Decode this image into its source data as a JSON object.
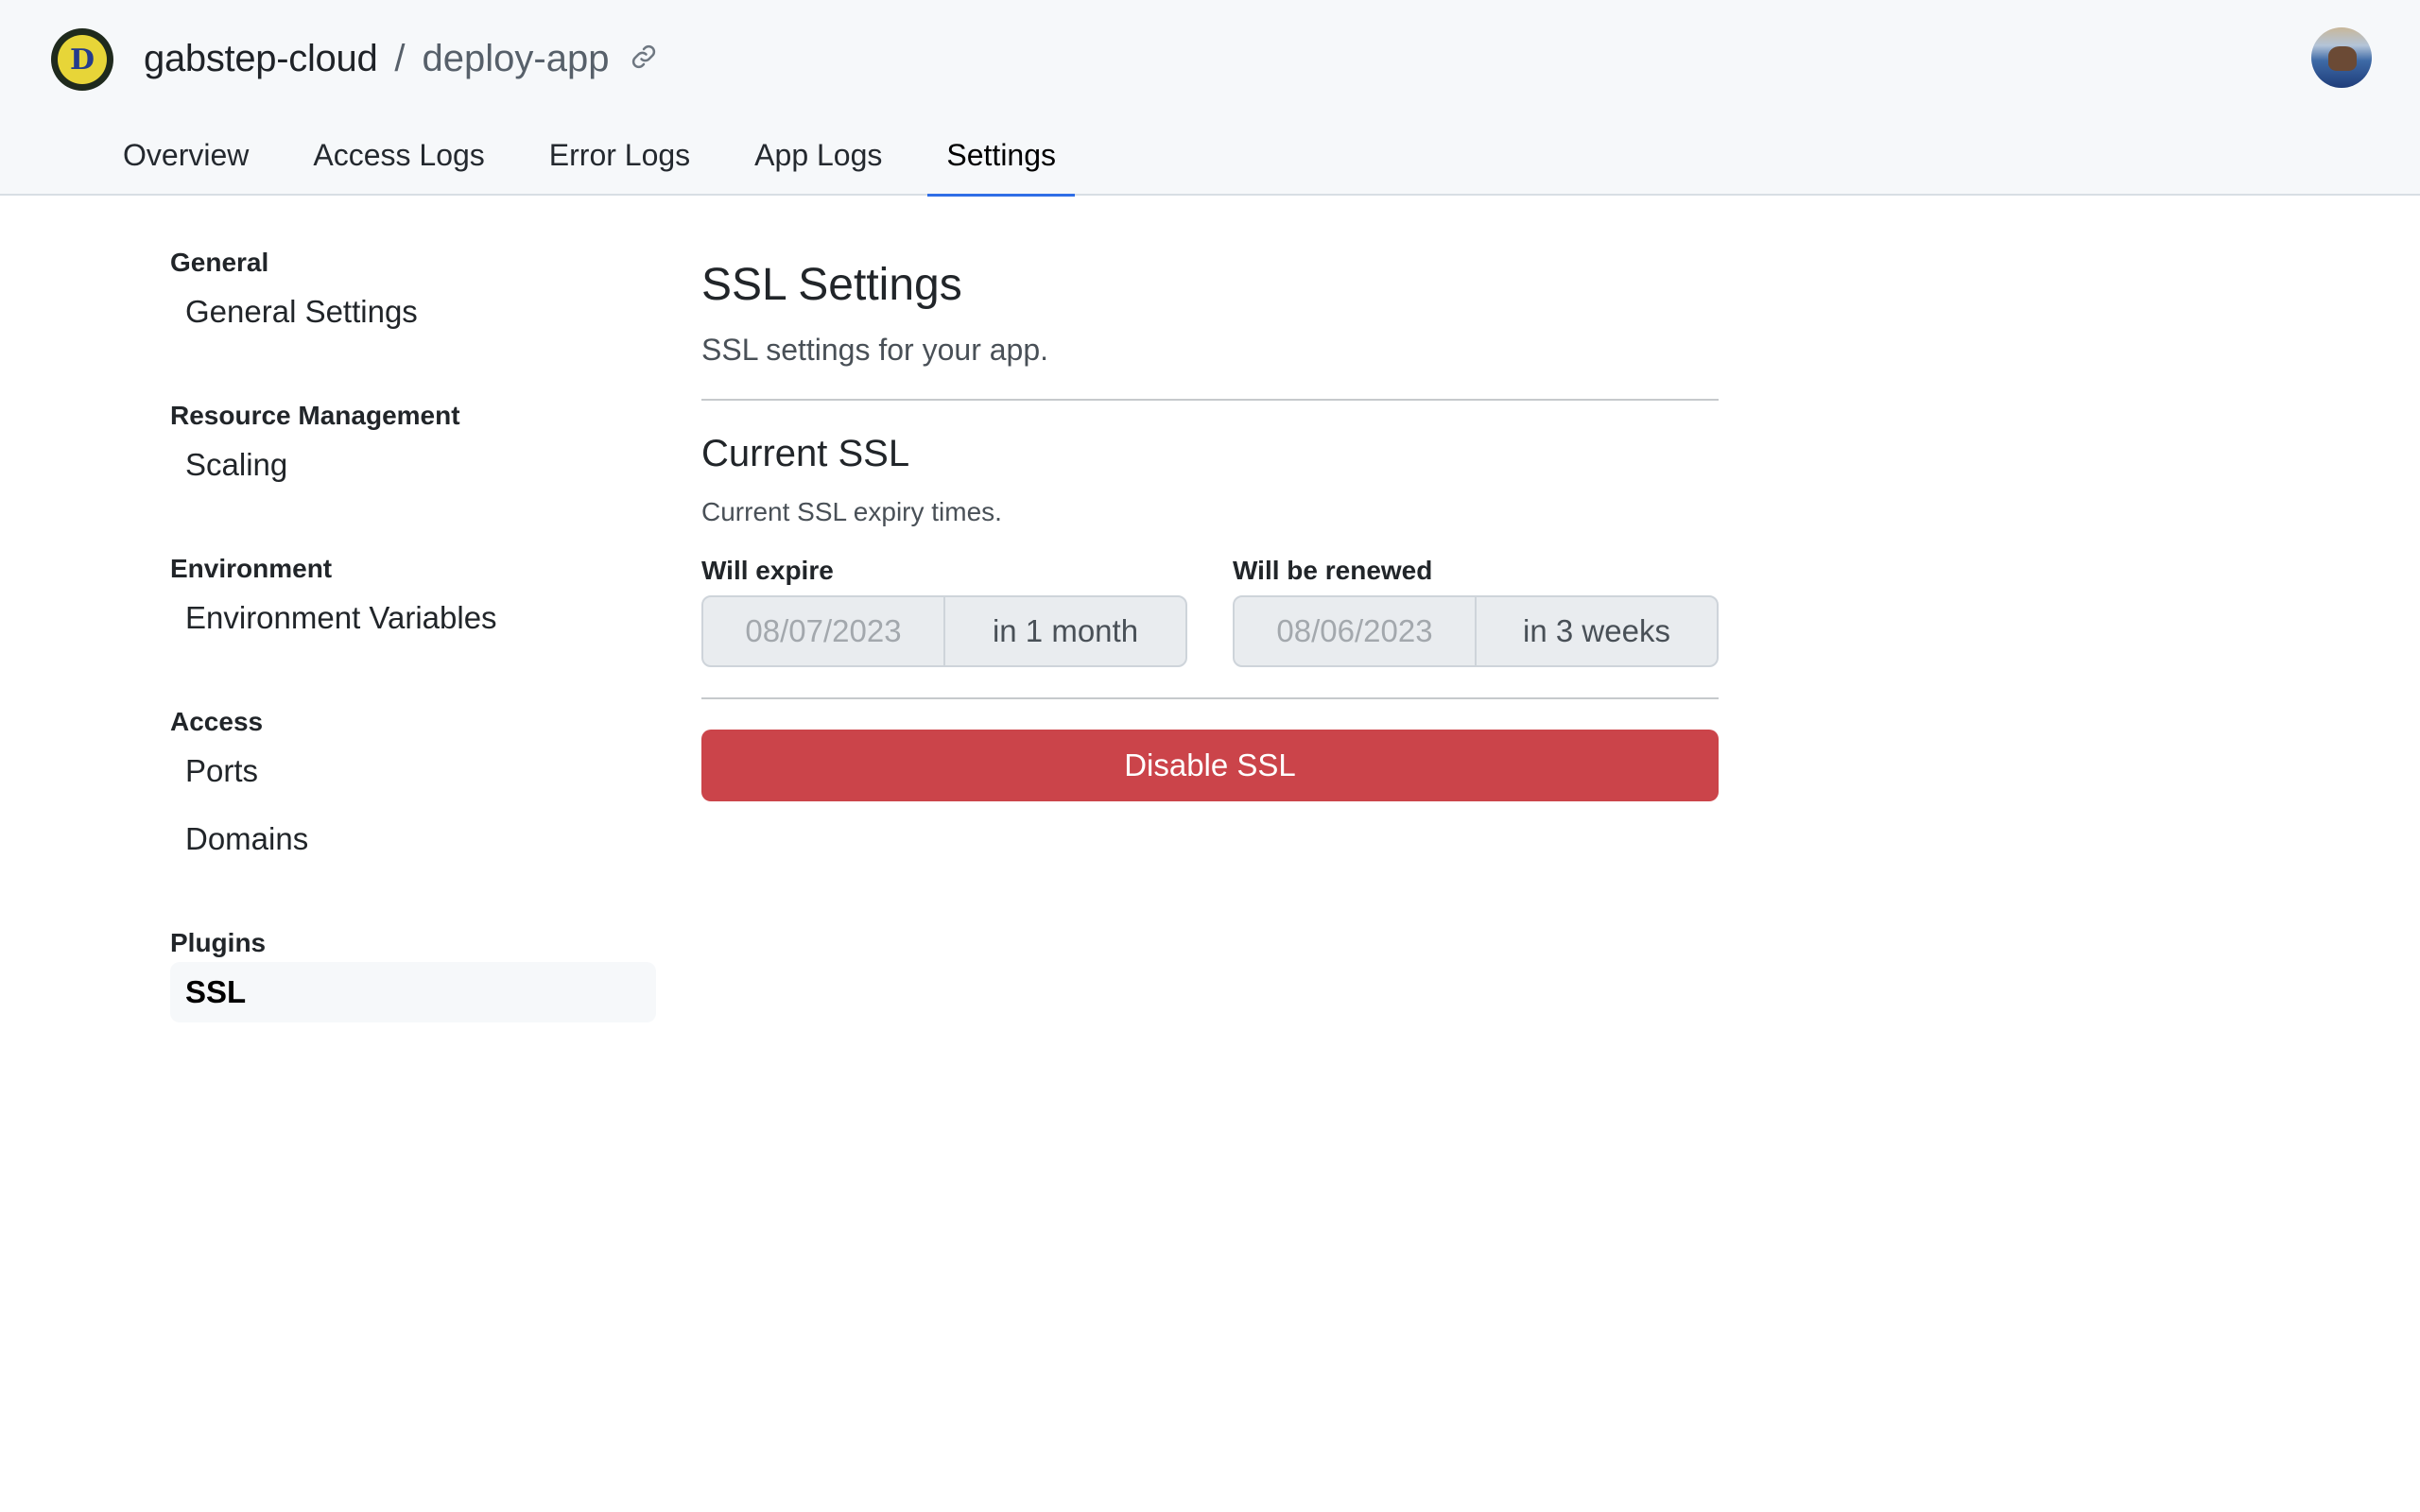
{
  "header": {
    "org_name": "gabstep-cloud",
    "separator": "/",
    "app_name": "deploy-app",
    "logo_letter": "D",
    "link_icon": "link-icon",
    "avatar_icon": "user-avatar"
  },
  "tabs": [
    {
      "label": "Overview",
      "active": false
    },
    {
      "label": "Access Logs",
      "active": false
    },
    {
      "label": "Error Logs",
      "active": false
    },
    {
      "label": "App Logs",
      "active": false
    },
    {
      "label": "Settings",
      "active": true
    }
  ],
  "sidebar": {
    "groups": [
      {
        "heading": "General",
        "items": [
          {
            "label": "General Settings",
            "active": false
          }
        ]
      },
      {
        "heading": "Resource Management",
        "items": [
          {
            "label": "Scaling",
            "active": false
          }
        ]
      },
      {
        "heading": "Environment",
        "items": [
          {
            "label": "Environment Variables",
            "active": false
          }
        ]
      },
      {
        "heading": "Access",
        "items": [
          {
            "label": "Ports",
            "active": false
          },
          {
            "label": "Domains",
            "active": false
          }
        ]
      },
      {
        "heading": "Plugins",
        "items": [
          {
            "label": "SSL",
            "active": true
          }
        ]
      }
    ]
  },
  "main": {
    "title": "SSL Settings",
    "subtitle": "SSL settings for your app.",
    "section_title": "Current SSL",
    "section_subtitle": "Current SSL expiry times.",
    "expire": {
      "label": "Will expire",
      "date": "08/07/2023",
      "relative": "in 1 month"
    },
    "renew": {
      "label": "Will be renewed",
      "date": "08/06/2023",
      "relative": "in 3 weeks"
    },
    "disable_button": "Disable SSL"
  },
  "colors": {
    "accent": "#2f6ee6",
    "danger": "#cb444a",
    "header_bg": "#f6f8fa",
    "logo_yellow": "#e7d538"
  }
}
